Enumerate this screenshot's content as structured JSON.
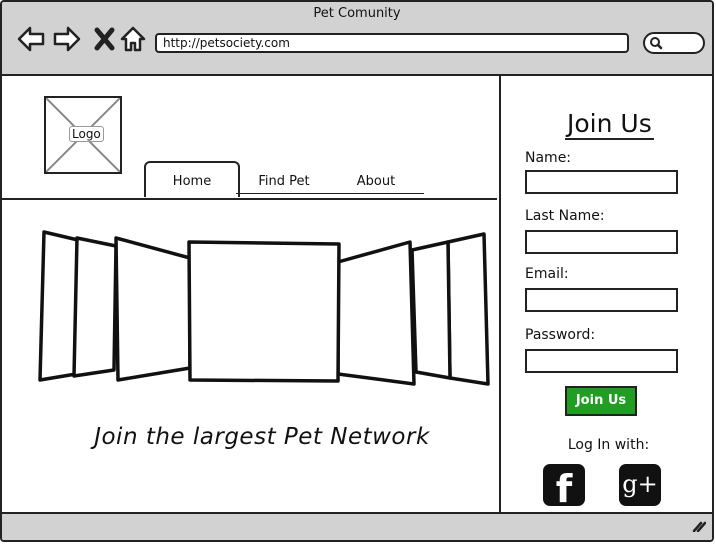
{
  "window": {
    "title": "Pet Comunity"
  },
  "browser": {
    "url": "http://petsociety.com",
    "icons": [
      "back-arrow-icon",
      "forward-arrow-icon",
      "close-icon",
      "home-icon",
      "search-icon"
    ]
  },
  "logo": {
    "label": "Logo"
  },
  "tabs": [
    {
      "label": "Home",
      "active": true
    },
    {
      "label": "Find Pet",
      "active": false
    },
    {
      "label": "About",
      "active": false
    }
  ],
  "main": {
    "tagline": "Join the largest Pet Network"
  },
  "signup": {
    "title": "Join Us",
    "fields": [
      {
        "label": "Name:",
        "value": ""
      },
      {
        "label": "Last Name:",
        "value": ""
      },
      {
        "label": "Email:",
        "value": ""
      },
      {
        "label": "Password:",
        "value": ""
      }
    ],
    "submit_label": "Join Us",
    "login_with": "Log In with:",
    "social": [
      {
        "name": "facebook",
        "glyph": "f"
      },
      {
        "name": "google-plus",
        "glyph": "g+"
      }
    ]
  },
  "colors": {
    "chrome": "#d2d2d2",
    "button": "#1f9e22",
    "stroke": "#222222"
  }
}
